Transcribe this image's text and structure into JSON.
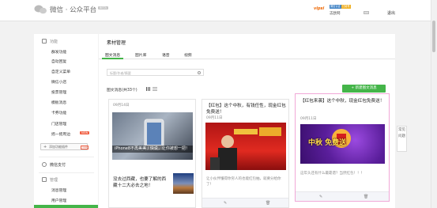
{
  "header": {
    "logo_text": "微信 · 公众平台",
    "beta_label": "BETA",
    "account_name": "vipsi",
    "badge_verified": "微信认证",
    "badge_subscription": "订阅号",
    "account_id": "志欧网",
    "logout": "退出"
  },
  "sidebar": {
    "sections": [
      {
        "title": "功能",
        "items": [
          "群发功能",
          "自动回复",
          "自定义菜单",
          "微信小店",
          "投票管理",
          "模板消息",
          "卡券功能",
          "门店管理",
          "摇一摇周边"
        ],
        "new_label": "NEW"
      },
      {
        "title": "微信支付"
      },
      {
        "title": "管理",
        "items": [
          "消息管理",
          "用户管理"
        ]
      }
    ],
    "add_plugin": "添加功能插件",
    "plugin_new": "new"
  },
  "main": {
    "title": "素材管理",
    "tabs": [
      "图文消息",
      "图片库",
      "语音",
      "视频"
    ],
    "search_placeholder": "标题/作者/摘要",
    "new_button": "+ 新建图文消息",
    "count_label": "图文消息(共33个)"
  },
  "cards": [
    {
      "date": "09月14日",
      "image_caption": "iPhone8不再美美 / 快说，让你被想一把！",
      "title": "",
      "sub_items": [
        {
          "title": "没去过西藏，也要了解的西藏十二大必去之地！"
        }
      ]
    },
    {
      "title": "【红包】这个中秋，有钱任性，现金红包免费送！",
      "date": "09月11日",
      "image_caption": "",
      "digest": "让小伙伴懂得你穷人的也能红包抽，就要分给你了！"
    },
    {
      "title": "【红包来袭】这个中秋，现金红包免费送！",
      "date": "09月11日",
      "image_text": "中秋 免费送",
      "digest": "这年头还有什么最靠谱？当然红包！！！"
    }
  ],
  "float_help": [
    "常见",
    "问题"
  ],
  "colors": {
    "accent": "#44b549",
    "highlight_border": "#f1a8d7"
  }
}
